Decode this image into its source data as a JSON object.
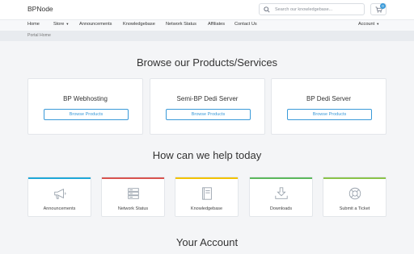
{
  "brand": "BPNode",
  "search": {
    "placeholder": "Search our knowledgebase..."
  },
  "cart": {
    "count": "0"
  },
  "nav": {
    "home": "Home",
    "store": "Store",
    "announcements": "Announcements",
    "knowledgebase": "Knowledgebase",
    "network_status": "Network Status",
    "affiliates": "Affiliates",
    "contact_us": "Contact Us",
    "account": "Account"
  },
  "breadcrumb": "Portal Home",
  "products_heading": "Browse our Products/Services",
  "products": [
    {
      "title": "BP Webhosting",
      "button": "Browse Products"
    },
    {
      "title": "Semi-BP Dedi Server",
      "button": "Browse Products"
    },
    {
      "title": "BP Dedi Server",
      "button": "Browse Products"
    }
  ],
  "help_heading": "How can we help today",
  "help_tiles": [
    {
      "label": "Announcements",
      "accent": "#1fa8d8",
      "icon": "megaphone-icon"
    },
    {
      "label": "Network Status",
      "accent": "#d9534f",
      "icon": "server-icon"
    },
    {
      "label": "Knowledgebase",
      "accent": "#f2c200",
      "icon": "book-icon"
    },
    {
      "label": "Downloads",
      "accent": "#5cb85c",
      "icon": "download-icon"
    },
    {
      "label": "Submit a Ticket",
      "accent": "#8bc34a",
      "icon": "lifebuoy-icon"
    }
  ],
  "account_heading": "Your Account",
  "colors": {
    "accent": "#3a9ad9",
    "background": "#f4f5f7"
  }
}
